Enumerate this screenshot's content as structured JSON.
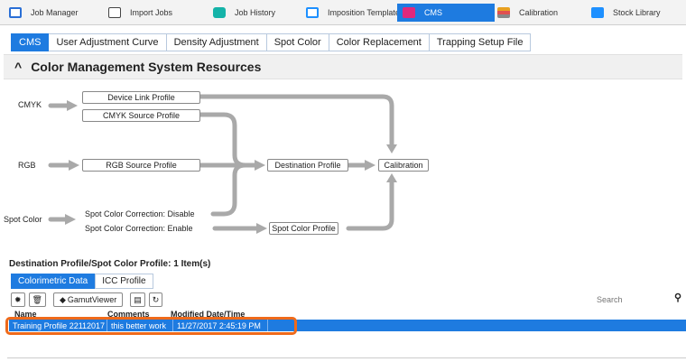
{
  "app_tabs": [
    {
      "label": "Job Manager",
      "icon": "job-manager-icon",
      "color": "#2a6fd6"
    },
    {
      "label": "Import Jobs",
      "icon": "import-icon",
      "color": "#2a6fd6"
    },
    {
      "label": "Job History",
      "icon": "history-icon",
      "color": "#14b3a8"
    },
    {
      "label": "Imposition Template",
      "icon": "imposition-icon",
      "color": "#1e90ff"
    },
    {
      "label": "CMS",
      "icon": "cms-icon",
      "color": "#e0287c",
      "active": true
    },
    {
      "label": "Calibration",
      "icon": "calibration-icon",
      "color": "#e8a020"
    },
    {
      "label": "Stock Library",
      "icon": "stock-icon",
      "color": "#1e90ff"
    }
  ],
  "sub_tabs": [
    "CMS",
    "User Adjustment Curve",
    "Density Adjustment",
    "Spot Color",
    "Color Replacement",
    "Trapping Setup File"
  ],
  "section": {
    "chevron": "^",
    "title": "Color Management System Resources"
  },
  "diagram": {
    "inputs": {
      "cmyk": "CMYK",
      "rgb": "RGB",
      "spot": "Spot Color"
    },
    "nodes": {
      "device_link": "Device Link Profile",
      "cmyk_source": "CMYK Source Profile",
      "rgb_source": "RGB Source Profile",
      "destination": "Destination Profile",
      "calibration": "Calibration",
      "spot_profile": "Spot Color Profile"
    },
    "spot_disable": "Spot Color Correction: Disable",
    "spot_enable": "Spot Color Correction: Enable"
  },
  "bottom": {
    "title": "Destination Profile/Spot Color Profile: 1 Item(s)",
    "tabs": [
      "Colorimetric Data",
      "ICC Profile"
    ],
    "toolbar": {
      "gamut_viewer": "GamutViewer"
    },
    "search_placeholder": "Search",
    "columns": [
      "Name",
      "Comments",
      "Modified Date/Time"
    ],
    "rows": [
      {
        "name": "Training Profile 22112017",
        "comments": "this better work",
        "modified": "11/27/2017 2:45:19 PM"
      }
    ]
  },
  "colors": {
    "accent": "#1e7be0",
    "highlight": "#ef6a1a",
    "arrow": "#a9a9a9"
  }
}
